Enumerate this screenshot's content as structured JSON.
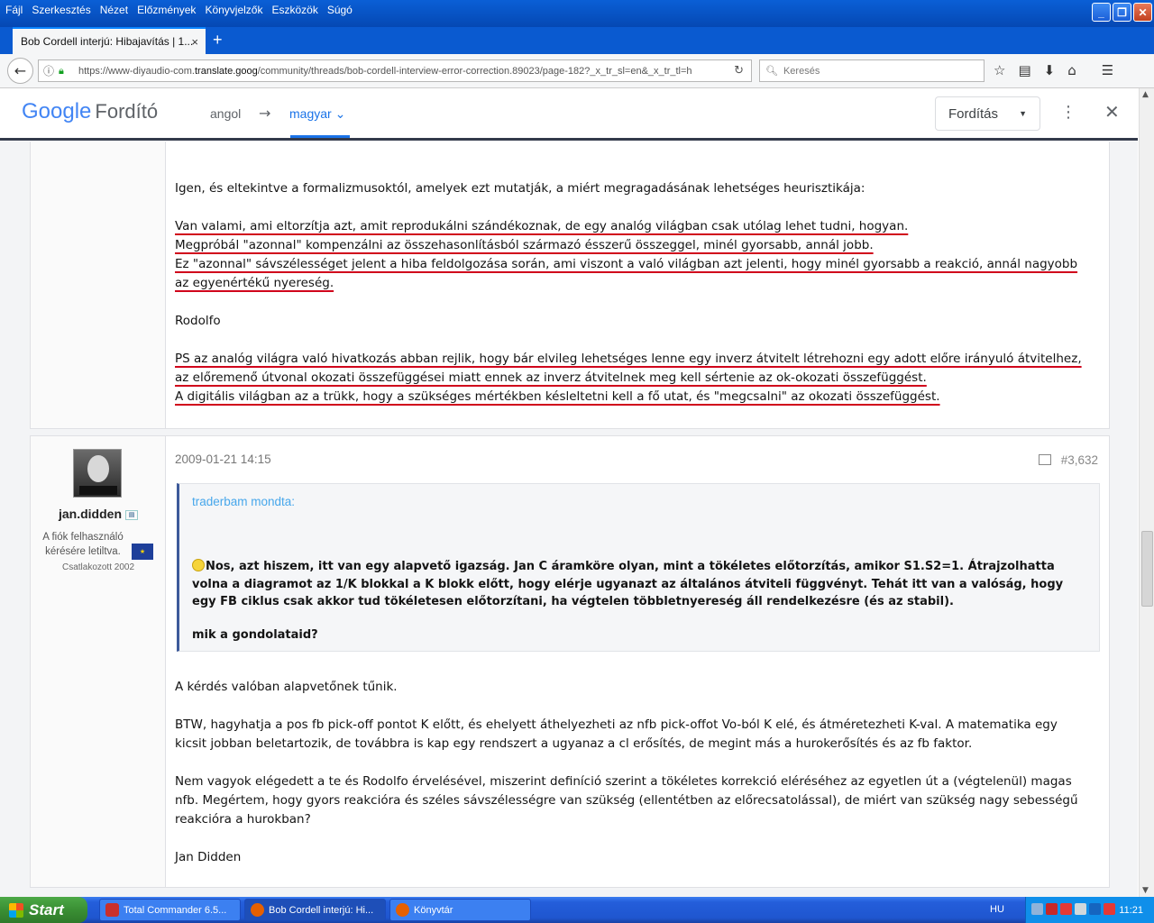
{
  "menu": [
    "Fájl",
    "Szerkesztés",
    "Nézet",
    "Előzmények",
    "Könyvjelzők",
    "Eszközök",
    "Súgó"
  ],
  "tab": {
    "title": "Bob Cordell interjú: Hibajavítás | 1...",
    "close": "×",
    "new": "+"
  },
  "nav": {
    "url_pre": "https://www-diyaudio-com.",
    "url_host": "translate.goog",
    "url_post": "/community/threads/bob-cordell-interview-error-correction.89023/page-182?_x_tr_sl=en&_x_tr_tl=h",
    "search_placeholder": "Keresés"
  },
  "translate": {
    "logo_google": "Google",
    "logo_product": "Fordító",
    "source_lang": "angol",
    "arrow": "→",
    "target_lang": "magyar",
    "mode": "Fordítás"
  },
  "post1": {
    "p1": "Igen, és eltekintve a formalizmusoktól, amelyek ezt mutatják, a miért megragadásának lehetséges heurisztikája:",
    "p2a": "Van valami, ami eltorzítja azt, amit reprodukálni szándékoznak, de egy analóg világban csak utólag lehet tudni, hogyan.",
    "p2b": "Megpróbál \"azonnal\" kompenzálni az összehasonlításból származó ésszerű összeggel, minél gyorsabb, annál jobb.",
    "p2c": "Ez \"azonnal\" sávszélességet jelent a hiba feldolgozása során, ami viszont a való világban azt jelenti, hogy minél gyorsabb a reakció, annál nagyobb az egyenértékű nyereség.",
    "sig": "Rodolfo",
    "p3a": "PS az analóg világra való hivatkozás abban rejlik, hogy bár elvileg lehetséges lenne egy inverz átvitelt létrehozni egy adott előre irányuló átvitelhez, az előremenő útvonal okozati összefüggései miatt ennek az inverz átvitelnek meg kell sértenie az ok-okozati összefüggést.",
    "p3b": "A digitális világban az a trükk, hogy a szükséges mértékben késleltetni kell a fő utat, és \"megcsalni\" az okozati összefüggést."
  },
  "post2": {
    "username": "jan.didden",
    "status": "A fiók felhasználó kérésére letiltva.",
    "joined": "Csatlakozott 2002",
    "date": "2009-01-21 14:15",
    "number": "#3,632",
    "quote_author": "traderbam mondta:",
    "quote_text": "Nos, azt hiszem, itt van egy alapvető igazság. Jan C áramköre olyan, mint a tökéletes előtorzítás, amikor S1.S2=1. Átrajzolhatta volna a diagramot az 1/K blokkal a K blokk előtt, hogy elérje ugyanazt az általános átviteli függvényt. Tehát itt van a valóság, hogy egy FB ciklus csak akkor tud tökéletesen előtorzítani, ha végtelen többletnyereség áll rendelkezésre (és az stabil).",
    "quote_q": "mik a gondolataid?",
    "r1": "A kérdés valóban alapvetőnek tűnik.",
    "r2": "BTW, hagyhatja a pos fb pick-off pontot K előtt, és ehelyett áthelyezheti az nfb pick-offot Vo-ból K elé, és átméretezheti K-val. A matematika egy kicsit jobban beletartozik, de továbbra is kap egy rendszert a ugyanaz a cl erősítés, de megint más a hurokerősítés és az fb faktor.",
    "r3": "Nem vagyok elégedett a te és Rodolfo érvelésével, miszerint definíció szerint a tökéletes korrekció eléréséhez az egyetlen út a (végtelenül) magas nfb. Megértem, hogy gyors reakcióra és széles sávszélességre van szükség (ellentétben az előrecsatolással), de miért van szükség nagy sebességű reakcióra a hurokban?",
    "sig": "Jan Didden"
  },
  "taskbar": {
    "start": "Start",
    "tasks": [
      "Total Commander 6.5...",
      "Bob Cordell interjú: Hi...",
      "Könyvtár"
    ],
    "lang": "HU",
    "clock": "11:21"
  }
}
